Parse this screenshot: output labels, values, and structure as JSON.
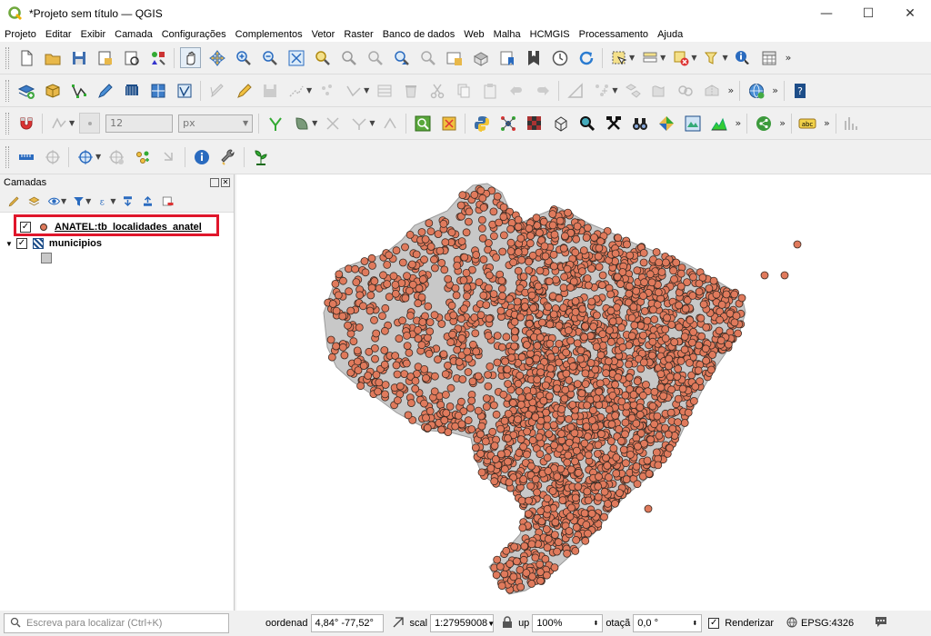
{
  "window": {
    "title": "*Projeto sem título — QGIS",
    "minimize": "—",
    "maximize": "☐",
    "close": "✕"
  },
  "menu": [
    "Projeto",
    "Editar",
    "Exibir",
    "Camada",
    "Configurações",
    "Complementos",
    "Vetor",
    "Raster",
    "Banco de dados",
    "Web",
    "Malha",
    "HCMGIS",
    "Processamento",
    "Ajuda"
  ],
  "toolbar": {
    "size_value": "12",
    "unit_value": "px",
    "label_icon_text": "abc"
  },
  "panel": {
    "title": "Camadas",
    "layers": [
      {
        "name": "ANATEL:tb_localidades_anatel",
        "checked": true
      },
      {
        "name": "municipios",
        "checked": true
      }
    ]
  },
  "colors": {
    "point_fill": "#e07a5c",
    "point_stroke": "#3a2a22",
    "polygon_fill": "#c8c8c8",
    "highlight": "#e0162b"
  },
  "status": {
    "locator_placeholder": "Escreva para localizar (Ctrl+K)",
    "coord_label": "oordenad",
    "coord_value": "4,84°  -77,52°",
    "scale_label": "scal",
    "scale_value": "1:27959008",
    "magnifier_label": "up",
    "magnifier_value": "100%",
    "rotation_label": "otaçã",
    "rotation_value": "0,0 °",
    "render_label": "Renderizar",
    "crs": "EPSG:4326"
  }
}
